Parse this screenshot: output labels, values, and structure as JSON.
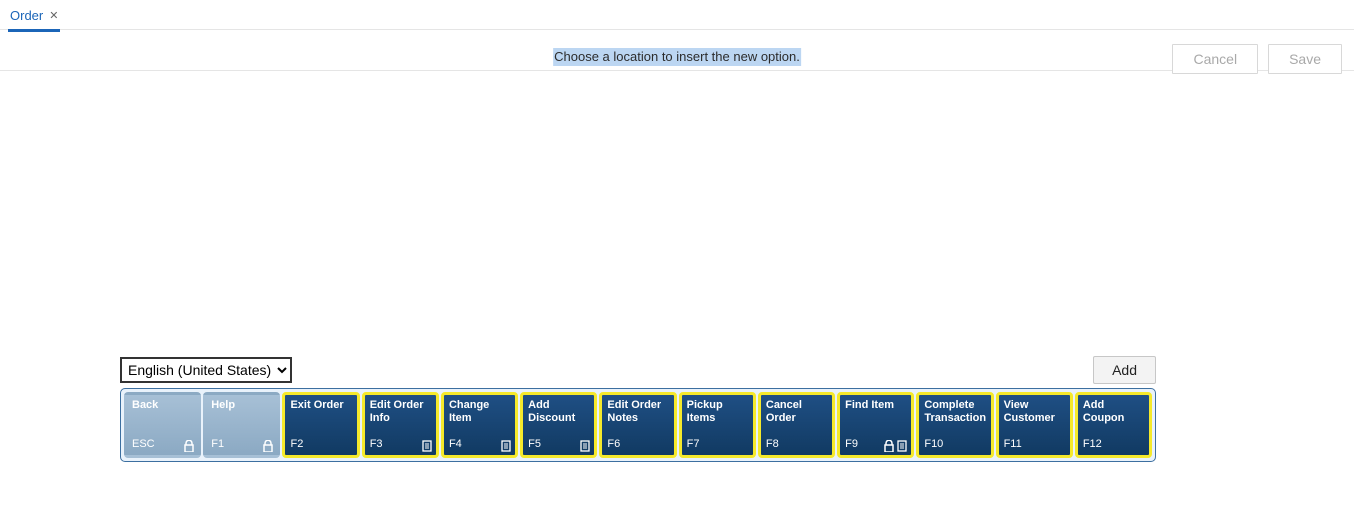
{
  "tab": {
    "label": "Order"
  },
  "header": {
    "instruction": "Choose a location to insert the new option.",
    "cancel": "Cancel",
    "save": "Save"
  },
  "language": {
    "selected": "English (United States)",
    "options": [
      "English (United States)"
    ]
  },
  "add_label": "Add",
  "fkeys": [
    {
      "label": "Back",
      "key": "ESC",
      "enabled": false,
      "lock": true,
      "aux": false
    },
    {
      "label": "Help",
      "key": "F1",
      "enabled": false,
      "lock": true,
      "aux": false
    },
    {
      "label": "Exit Order",
      "key": "F2",
      "enabled": true,
      "lock": false,
      "aux": false
    },
    {
      "label": "Edit Order Info",
      "key": "F3",
      "enabled": true,
      "lock": false,
      "aux": true
    },
    {
      "label": "Change Item",
      "key": "F4",
      "enabled": true,
      "lock": false,
      "aux": true
    },
    {
      "label": "Add Discount",
      "key": "F5",
      "enabled": true,
      "lock": false,
      "aux": true
    },
    {
      "label": "Edit Order Notes",
      "key": "F6",
      "enabled": true,
      "lock": false,
      "aux": false
    },
    {
      "label": "Pickup Items",
      "key": "F7",
      "enabled": true,
      "lock": false,
      "aux": false
    },
    {
      "label": "Cancel Order",
      "key": "F8",
      "enabled": true,
      "lock": false,
      "aux": false
    },
    {
      "label": "Find Item",
      "key": "F9",
      "enabled": true,
      "lock": true,
      "aux": true
    },
    {
      "label": "Complete Transaction",
      "key": "F10",
      "enabled": true,
      "lock": false,
      "aux": false
    },
    {
      "label": "View Customer",
      "key": "F11",
      "enabled": true,
      "lock": false,
      "aux": false
    },
    {
      "label": "Add Coupon",
      "key": "F12",
      "enabled": true,
      "lock": false,
      "aux": false
    }
  ],
  "colors": {
    "tab_active": "#1b65b8",
    "fkey_highlight": "#f5e92b",
    "fkey_bg_top": "#1f4f84",
    "fkey_bg_bottom": "#113a62",
    "fkey_disabled_top": "#a7c0d6"
  }
}
